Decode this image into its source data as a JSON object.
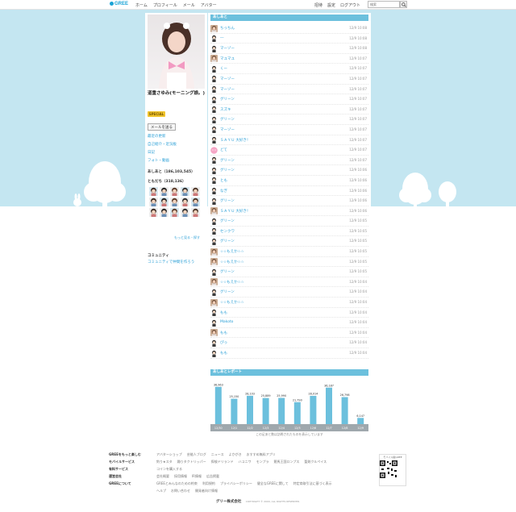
{
  "header": {
    "logo": "GREE",
    "nav": [
      "ホーム",
      "プロフィール",
      "メール",
      "アバター"
    ],
    "right_nav": [
      "招待",
      "設定",
      "ログアウト"
    ],
    "search_placeholder": "検索"
  },
  "profile": {
    "name": "道重さゆみ(モーニング娘。)",
    "badge": "SPECIAL",
    "mail_button": "メールを送る",
    "links": [
      "最近の更新",
      "自己紹介・近況板",
      "日記",
      "フォト・動画"
    ],
    "ashiato_label": "あしあと（186,103,545）",
    "friends_label": "ともだち（318,136）",
    "friends_more": "もっと見る・探す",
    "community_label": "コミュニティ",
    "community_link": "コミュニティで仲間を作ろう"
  },
  "ashiato": {
    "title": "あしあと",
    "rows": [
      {
        "name": "ちっちん",
        "time": "12/9 10:08",
        "avatar": "photo"
      },
      {
        "name": "―",
        "time": "12/9 10:08",
        "avatar": "boy"
      },
      {
        "name": "マーゾー",
        "time": "12/9 10:08",
        "avatar": "boy"
      },
      {
        "name": "マユマユ",
        "time": "12/9 10:07",
        "avatar": "photo"
      },
      {
        "name": "くー",
        "time": "12/9 10:07",
        "avatar": "boy"
      },
      {
        "name": "マーゾー",
        "time": "12/9 10:07",
        "avatar": "boy"
      },
      {
        "name": "マーゾー",
        "time": "12/9 10:07",
        "avatar": "boy"
      },
      {
        "name": "グリーン",
        "time": "12/9 10:07",
        "avatar": "boy"
      },
      {
        "name": "スズキ",
        "time": "12/9 10:07",
        "avatar": "boy"
      },
      {
        "name": "グリーン",
        "time": "12/9 10:07",
        "avatar": "boy"
      },
      {
        "name": "マーゾー",
        "time": "12/9 10:07",
        "avatar": "boy"
      },
      {
        "name": "ＳＡＹＵ 大好き！",
        "time": "12/9 10:07",
        "avatar": "boy"
      },
      {
        "name": "どて",
        "time": "12/9 10:07",
        "avatar": "pink"
      },
      {
        "name": "グリーン",
        "time": "12/9 10:07",
        "avatar": "boy"
      },
      {
        "name": "グリーン",
        "time": "12/9 10:06",
        "avatar": "boy"
      },
      {
        "name": "とも",
        "time": "12/9 10:06",
        "avatar": "boy"
      },
      {
        "name": "なぎ",
        "time": "12/9 10:06",
        "avatar": "boy"
      },
      {
        "name": "グリーン",
        "time": "12/9 10:06",
        "avatar": "boy"
      },
      {
        "name": "ＳＡＹＵ 大好き！",
        "time": "12/9 10:06",
        "avatar": "photo"
      },
      {
        "name": "グリーン",
        "time": "12/9 10:05",
        "avatar": "boy"
      },
      {
        "name": "センクワ",
        "time": "12/9 10:05",
        "avatar": "boy"
      },
      {
        "name": "グリーン",
        "time": "12/9 10:05",
        "avatar": "boy"
      },
      {
        "name": "☆☆もえか☆☆",
        "time": "12/9 10:05",
        "avatar": "photo"
      },
      {
        "name": "☆☆もえか☆☆",
        "time": "12/9 10:05",
        "avatar": "photo"
      },
      {
        "name": "グリーン",
        "time": "12/9 10:05",
        "avatar": "boy"
      },
      {
        "name": "☆☆もえか☆☆",
        "time": "12/9 10:04",
        "avatar": "photo"
      },
      {
        "name": "グリーン",
        "time": "12/9 10:04",
        "avatar": "boy"
      },
      {
        "name": "☆☆もえか☆☆",
        "time": "12/9 10:04",
        "avatar": "photo"
      },
      {
        "name": "もも",
        "time": "12/9 10:04",
        "avatar": "boy"
      },
      {
        "name": "Makoto",
        "time": "12/9 10:04",
        "avatar": "boy"
      },
      {
        "name": "もも",
        "time": "12/9 10:04",
        "avatar": "photo"
      },
      {
        "name": "ぴっ",
        "time": "12/9 10:04",
        "avatar": "boy"
      },
      {
        "name": "もも",
        "time": "12/9 10:04",
        "avatar": "boy"
      }
    ]
  },
  "report": {
    "title": "あしあとレポート",
    "note": "この足あと数は訪問されたものを表示しています"
  },
  "chart_data": {
    "type": "bar",
    "categories": [
      "12/30",
      "12/1",
      "12/2",
      "12/3",
      "12/4",
      "12/5",
      "12/6",
      "12/7",
      "12/8",
      "12/9"
    ],
    "values": [
      36963,
      25150,
      28103,
      25889,
      25990,
      21790,
      28014,
      36187,
      26798,
      6147
    ],
    "data_labels": [
      "36,963",
      "25,150",
      "28,103",
      "25,889",
      "25,990",
      "21,790",
      "28,014",
      "36,187",
      "26,798",
      "6,147"
    ],
    "ylim": [
      0,
      40000
    ],
    "bar_color": "#6cc0dd"
  },
  "footer": {
    "col1": [
      "GREEをもっと楽しむ",
      "モバイルサービス",
      "有料サービス",
      "運営会社",
      "GREEについて"
    ],
    "lines": [
      [
        "アバターショップ",
        "芸能人ブログ",
        "ニュース",
        "よかがき",
        "おすすめ無料アプリ"
      ],
      [
        "釣り★スタ",
        "踊りタクトリッパー",
        "探検ドリランド",
        "ハコニワ",
        "モンプラ",
        "競馬王国ロンプス",
        "聖剣クルペイス"
      ],
      [
        "コインを購入する"
      ],
      [
        "会社概要",
        "採用情報",
        "IR情報",
        "広告掲載"
      ],
      [
        "GREEとみんなのための約束",
        "利用規約",
        "プライバシーポリシー",
        "健全なGREEに関して",
        "特定商取引法に基づく表示"
      ],
      [
        "ヘルプ",
        "お問い合わせ",
        "開発者向け情報"
      ]
    ],
    "qr_caption": "モバイル版GREE",
    "corp_name": "グリー株式会社",
    "copyright": "COPYRIGHT © 2009, ALL RIGHTS RESERVED."
  }
}
